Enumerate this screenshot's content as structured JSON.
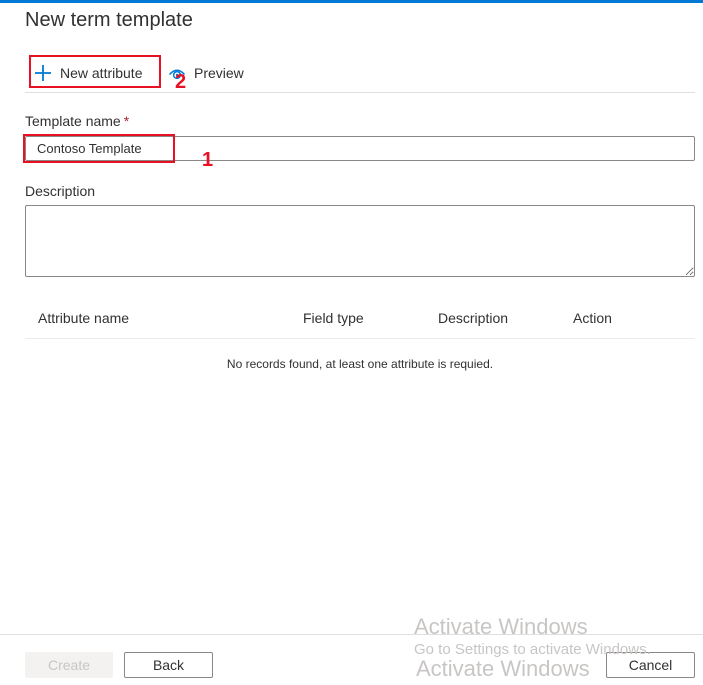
{
  "header": {
    "title": "New term template"
  },
  "toolbar": {
    "new_attribute_label": "New attribute",
    "preview_label": "Preview"
  },
  "form": {
    "template_name_label": "Template name",
    "required_marker": "*",
    "template_name_value": "Contoso Template",
    "description_label": "Description",
    "description_value": ""
  },
  "table": {
    "columns": [
      "Attribute name",
      "Field type",
      "Description",
      "Action"
    ],
    "empty_message": "No records found, at least one attribute is requied."
  },
  "footer": {
    "create_label": "Create",
    "back_label": "Back",
    "cancel_label": "Cancel"
  },
  "annotations": {
    "callout_1": "1",
    "callout_2": "2"
  },
  "watermark": {
    "line1": "Activate Windows",
    "line2": "Go to Settings to activate Windows.",
    "line3": "Activate Windows"
  },
  "colors": {
    "accent": "#0078d4",
    "required": "#a4262c",
    "callout": "#e81123",
    "disabled_text": "#c8c6c4"
  },
  "icons": {
    "new_attribute": "plus-icon",
    "preview": "eye-icon"
  }
}
